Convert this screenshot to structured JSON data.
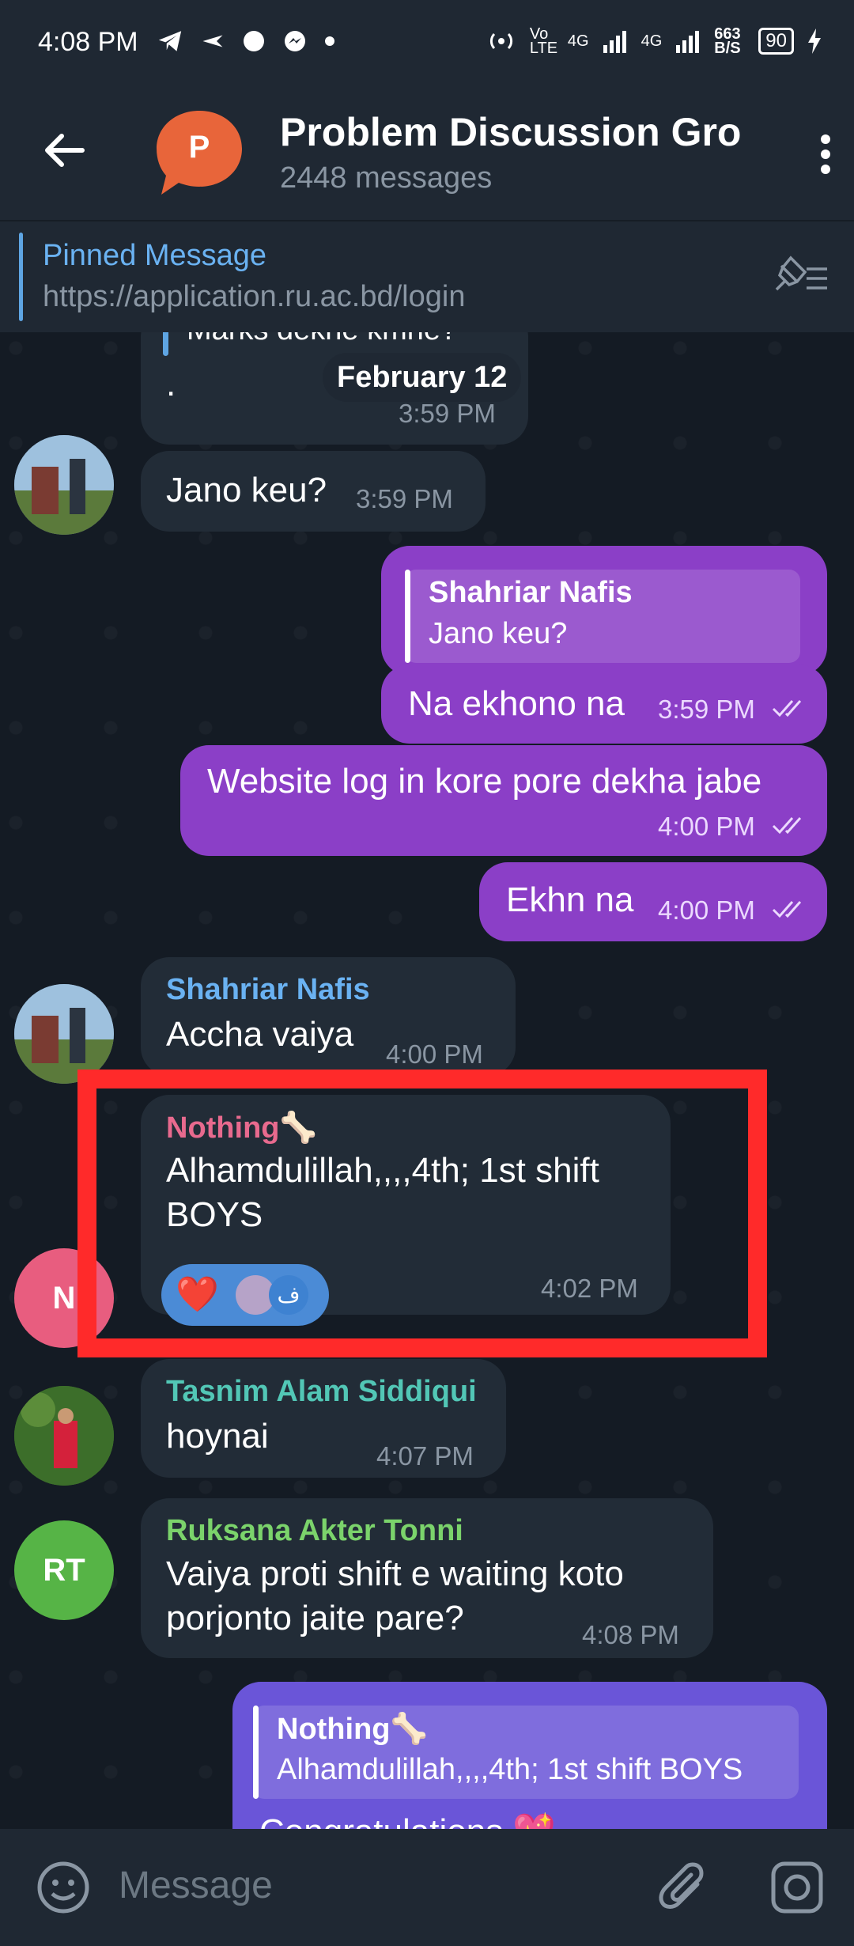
{
  "status_bar": {
    "time": "4:08 PM",
    "network_rate": "663 B/S",
    "signal_labels": [
      "Vo LTE",
      "4G",
      "4G"
    ],
    "battery": "90"
  },
  "header": {
    "group_initial": "P",
    "title": "Problem Discussion Gro",
    "subtitle": "2448 messages"
  },
  "pinned": {
    "title": "Pinned Message",
    "text": "https://application.ru.ac.bd/login"
  },
  "chat": {
    "date_chip": "February 12",
    "messages": [
      {
        "quote": "Marks dekhe kmne?",
        "text": ".",
        "time": "3:59 PM"
      },
      {
        "text": "Jano keu?",
        "time": "3:59 PM"
      },
      {
        "reply_name": "Shahriar Nafis",
        "reply_text": "Jano keu?",
        "text": "Na ekhono na",
        "time": "3:59 PM"
      },
      {
        "text": "Website log in kore pore dekha jabe",
        "time": "4:00 PM"
      },
      {
        "text": "Ekhn na",
        "time": "4:00 PM"
      },
      {
        "name": "Shahriar Nafis",
        "text": "Accha vaiya",
        "time": "4:00 PM"
      },
      {
        "name": "Nothing🦴",
        "text": "Alhamdulillah,,,,4th; 1st shift BOYS",
        "time": "4:02 PM",
        "reaction": "❤️",
        "reactor_initial": "ف"
      },
      {
        "name": "Tasnim Alam Siddiqui",
        "text": "hoynai",
        "time": "4:07 PM"
      },
      {
        "name": "Ruksana Akter Tonni",
        "text": "Vaiya proti shift e waiting koto porjonto jaite pare?",
        "time": "4:08 PM"
      },
      {
        "reply_name": "Nothing🦴",
        "reply_text": "Alhamdulillah,,,,4th; 1st shift BOYS",
        "text": "Congratulations 💖"
      }
    ],
    "avatars": {
      "nothing": "N",
      "ruksana": "RT"
    }
  },
  "input": {
    "placeholder": "Message"
  },
  "colors": {
    "outgoing": "#8b3fc7",
    "incoming": "#222c37",
    "highlight": "#ff2a2a"
  }
}
